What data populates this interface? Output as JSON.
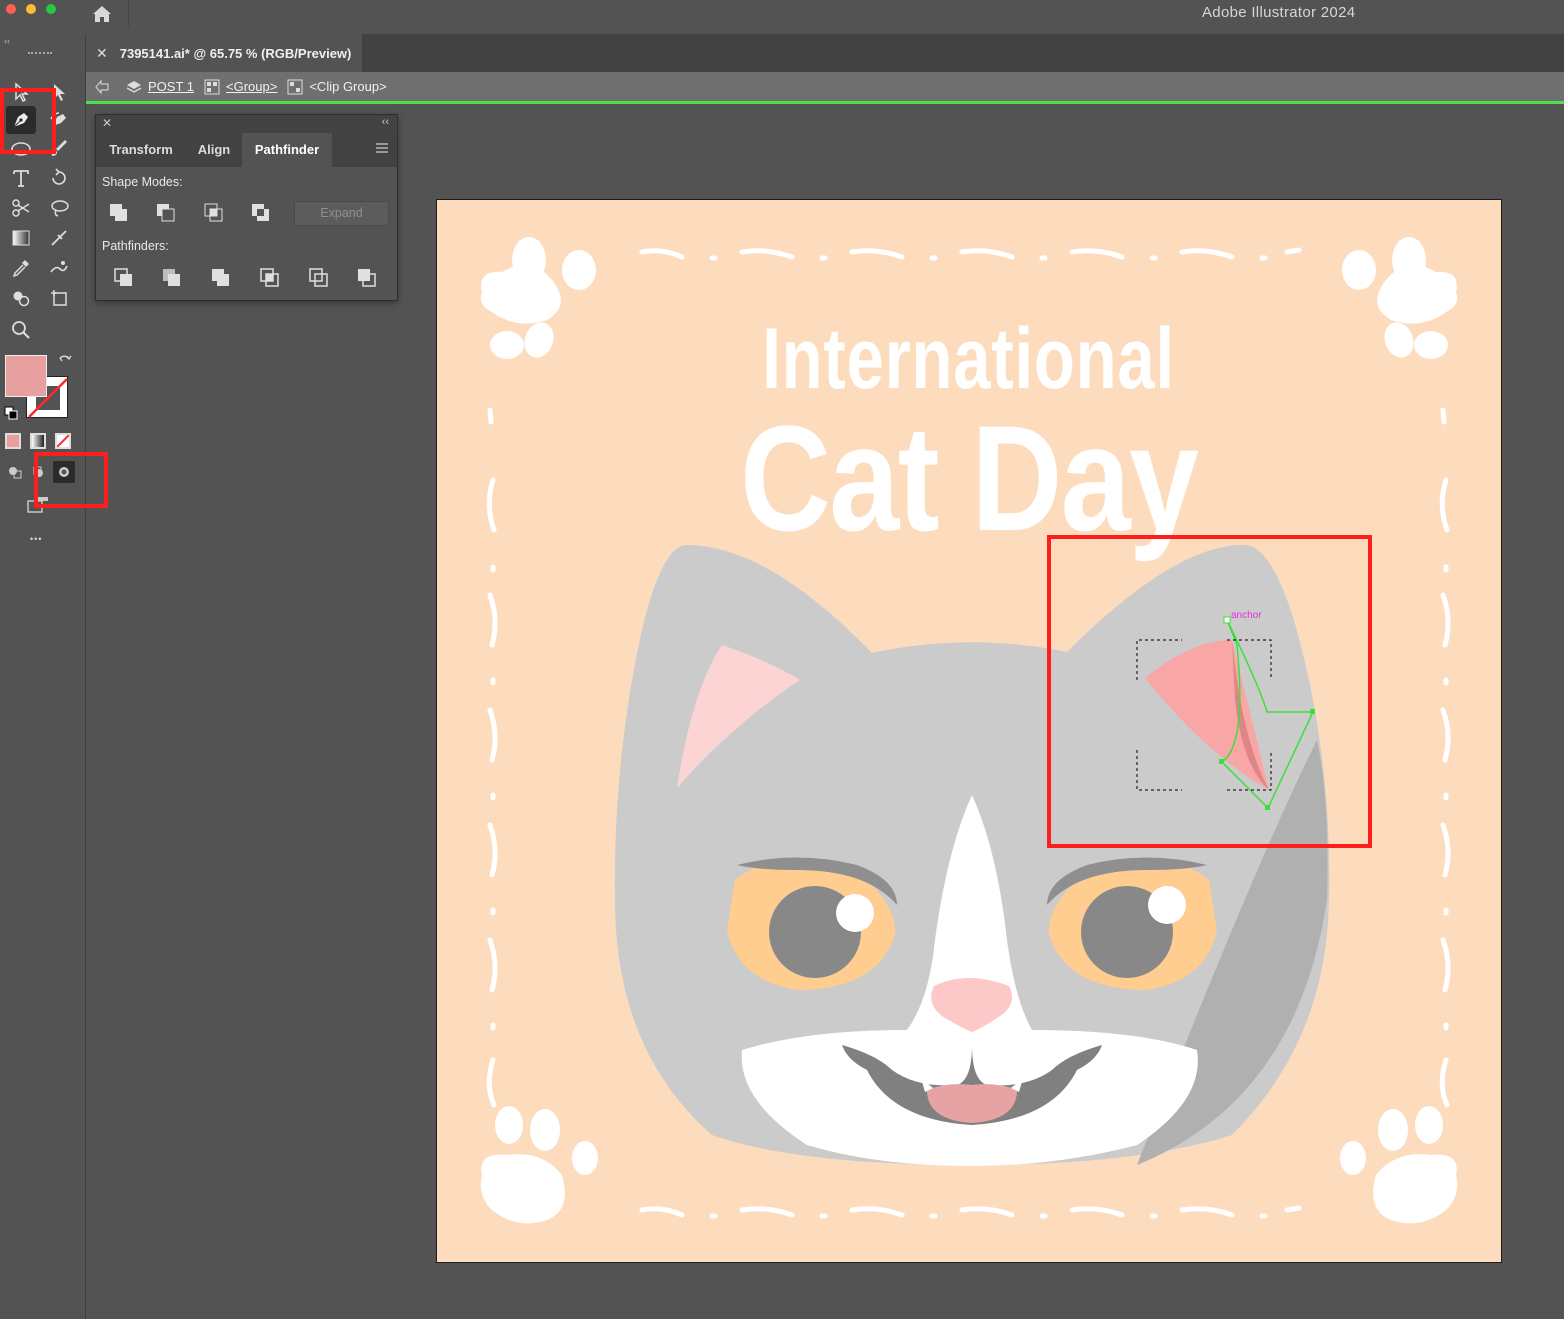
{
  "app": {
    "title": "Adobe Illustrator 2024",
    "traffic_lights": {
      "close": "#fe5f57",
      "minimize": "#febc2e",
      "zoom": "#28c840"
    }
  },
  "document": {
    "tab_label": "7395141.ai* @ 65.75 % (RGB/Preview)",
    "close_glyph": "✕"
  },
  "breadcrumb": {
    "items": [
      "POST 1",
      "<Group>",
      "<Clip Group>"
    ]
  },
  "toolbar": {
    "fill_color": "#e89f9f",
    "stroke_color": "none",
    "more_glyph": "•••",
    "tools": [
      "selection-tool",
      "direct-selection-tool",
      "pen-tool",
      "curvature-tool",
      "ellipse-tool",
      "paintbrush-tool",
      "type-tool",
      "rotate-tool",
      "scissors-tool",
      "lasso-tool",
      "gradient-tool",
      "eyedropper-tool",
      "color-picker-tool",
      "puppet-warp-tool",
      "shape-builder-tool",
      "artboard-tool",
      "zoom-tool"
    ]
  },
  "pathfinder_panel": {
    "tabs": [
      "Transform",
      "Align",
      "Pathfinder"
    ],
    "active_tab": "Pathfinder",
    "shape_modes_label": "Shape Modes:",
    "pathfinders_label": "Pathfinders:",
    "expand_label": "Expand",
    "close_glyph": "✕",
    "collapse_glyph": "‹‹"
  },
  "artwork": {
    "title_line1": "International",
    "title_line2": "Cat Day",
    "background_color": "#fddcbd",
    "anchor_label": "anchor"
  },
  "colors": {
    "ui_bg": "#535353",
    "highlight_green": "#4de04d",
    "annotation_red": "#ff1e1e"
  }
}
